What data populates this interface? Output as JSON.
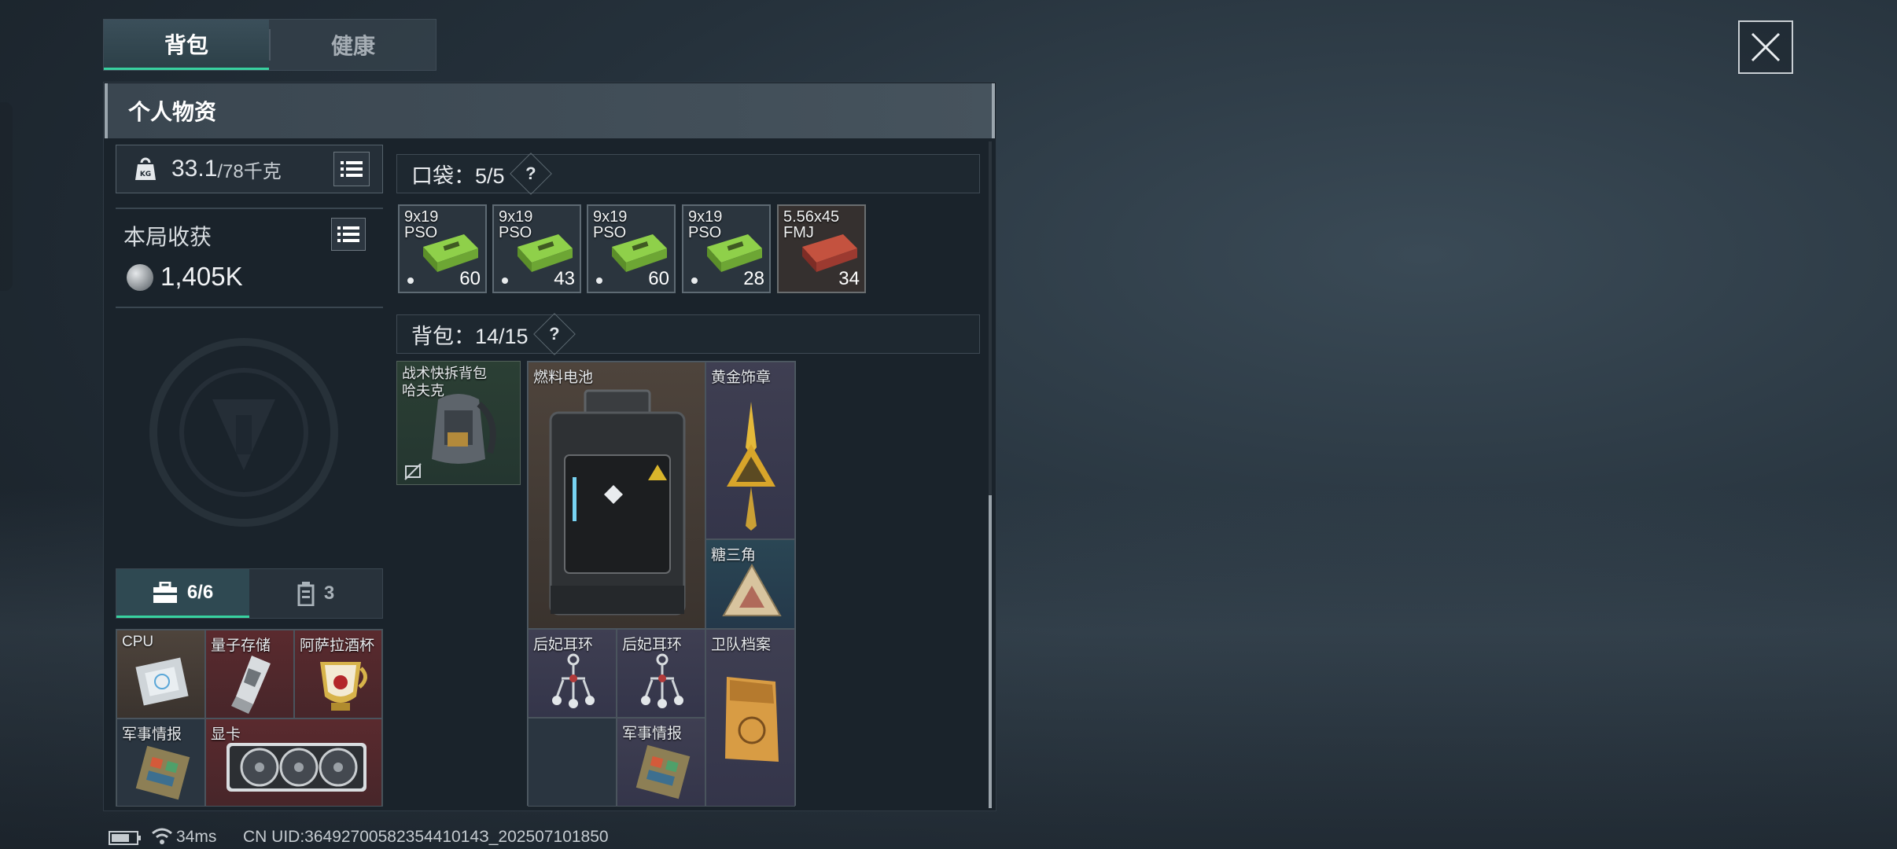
{
  "tabs": [
    {
      "label": "背包",
      "active": true
    },
    {
      "label": "健康",
      "active": false
    }
  ],
  "header": {
    "title": "个人物资"
  },
  "weight": {
    "value": "33.1",
    "max": "/78千克"
  },
  "haul": {
    "title": "本局收获",
    "value": "1,405K"
  },
  "container_tabs": [
    {
      "label": "6/6",
      "icon": "toolbox-icon",
      "active": true
    },
    {
      "label": "3",
      "icon": "canister-icon",
      "active": false
    }
  ],
  "container_items": [
    "CPU",
    "量子存储",
    "阿萨拉酒杯",
    "军事情报",
    "显卡"
  ],
  "pockets": {
    "label": "口袋：5/5",
    "help": "?"
  },
  "ammo": [
    {
      "name": "9x19\nPSO",
      "count": "60",
      "color": "#7fbf3a"
    },
    {
      "name": "9x19\nPSO",
      "count": "43",
      "color": "#7fbf3a"
    },
    {
      "name": "9x19\nPSO",
      "count": "60",
      "color": "#7fbf3a"
    },
    {
      "name": "9x19\nPSO",
      "count": "28",
      "color": "#7fbf3a"
    },
    {
      "name": "5.56x45\nFMJ",
      "count": "34",
      "color": "#b8473e"
    }
  ],
  "backpack": {
    "label": "背包：14/15",
    "help": "?"
  },
  "backpack_items": {
    "bag": "战术快拆背包\n哈夫克",
    "battery": "燃料电池",
    "badge": "黄金饰章",
    "triangle": "糖三角",
    "earring1": "后妃耳环",
    "earring2": "后妃耳环",
    "archive": "卫队档案",
    "intel": "军事情报"
  },
  "footer": {
    "ping": "34ms",
    "uid": "CN UID:3649270058235441014З_202507101850"
  },
  "colors": {
    "accent": "#38d2a0",
    "panel": "#1a232b"
  }
}
